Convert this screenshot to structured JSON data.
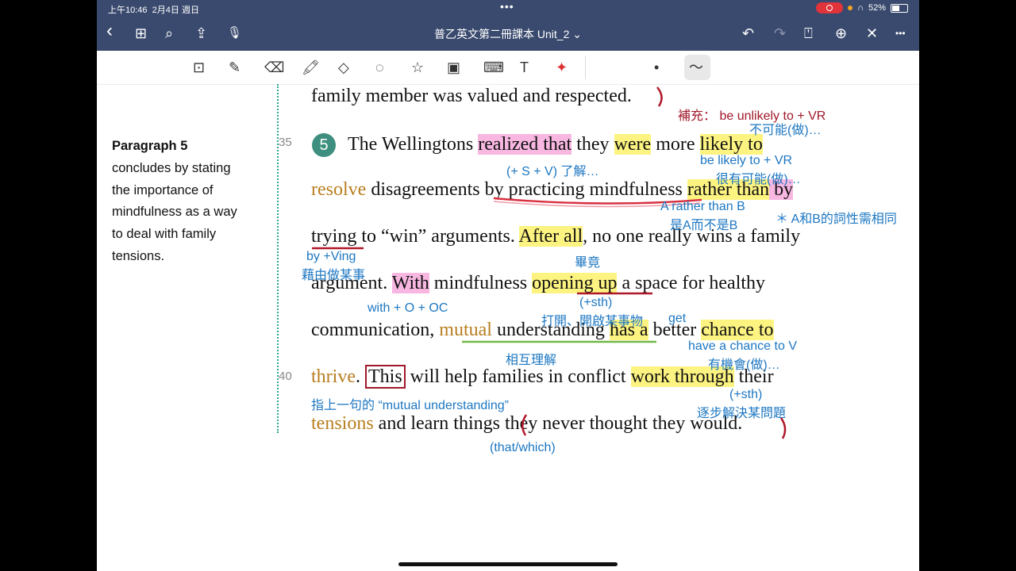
{
  "status": {
    "time": "上午10:46",
    "date": "2月4日 週日",
    "battery": "52%"
  },
  "nav": {
    "title": "普乙英文第二冊課本 Unit_2 ⌄",
    "back": "‹",
    "grid": "⊞",
    "search": "⌕",
    "share": "⇪",
    "mic": "🎙",
    "undo": "↶",
    "redo": "↷",
    "bookmark": "⍞",
    "add": "⊕",
    "close": "✕",
    "more": "•••"
  },
  "tools": {
    "lasso_zoom": "⊡",
    "pen": "✎",
    "eraser": "⌫",
    "highlighter": "🖍",
    "shapes": "◇",
    "lasso": "◌",
    "sticker": "☆",
    "image": "▣",
    "keyboard": "⌨",
    "textbox": "T",
    "laser": "✦",
    "dot": "•",
    "stroke": "〜"
  },
  "sidebar": {
    "heading": "Paragraph 5",
    "line1": "concludes by stating",
    "line2": "the importance of",
    "line3": "mindfulness as a way",
    "line4": "to deal with family",
    "line5": "tensions."
  },
  "line_numbers": {
    "n35": "35",
    "n40": "40"
  },
  "paragraph_number": "5",
  "text": {
    "l0": "family member was valued and respected.",
    "l1_a": "The Wellingtons ",
    "l1_b": "realized that",
    "l1_c": " they ",
    "l1_d": "were",
    "l1_e": " more ",
    "l1_f": "likely to",
    "l2_a": "resolve",
    "l2_b": " disagreements by practicing mindfulness ",
    "l2_c": "rather than",
    "l2_d": " by",
    "l3_a": "trying",
    "l3_b": " to “win” arguments. ",
    "l3_c": "After all",
    "l3_d": ", no one really wins a family",
    "l4_a": "argument. ",
    "l4_b": "With",
    "l4_c": " mindfulness ",
    "l4_d": "opening up",
    "l4_e": " a space for healthy",
    "l5_a": "communication, ",
    "l5_b": "mutual",
    "l5_c": " understanding ",
    "l5_d": "has a",
    "l5_e": " better ",
    "l5_f": "chance to",
    "l6_a": "thrive",
    "l6_b": ". ",
    "l6_c": "This",
    "l6_d": " will help families in conflict ",
    "l6_e": "work through",
    "l6_f": " their",
    "l7_a": "tensions",
    "l7_b": " and learn things they never thought they would."
  },
  "annotations": {
    "a1_red": "補充：  be unlikely to + VR",
    "a1b": "不可能(做)…",
    "a2": "(+ S + V) 了解…",
    "a3": "be likely to + VR",
    "a3b": "很有可能(做)…",
    "a4": "A rather than B",
    "a4b": "是A而不是B",
    "a5": "＊ A和B的詞性需相同",
    "a6": "by +Ving",
    "a6b": "藉由做某事",
    "a7": "畢竟",
    "a8": "with + O + OC",
    "a9": "(+sth)",
    "a9b": "打開、開啟某事物",
    "a10": "get",
    "a11": "have a chance to V",
    "a11b": "有機會(做)…",
    "a12": "相互理解",
    "a13": "指上一句的 “mutual understanding”",
    "a14": "(+sth)",
    "a14b": "逐步解決某問題",
    "a15": "(that/which)"
  },
  "colors": {
    "nav_bg": "#3a4a6e",
    "highlight_yellow": "#fcf381",
    "highlight_pink": "#f7b7e1",
    "ink_blue": "#1d77c2",
    "ink_red": "#a0182a",
    "word_orange": "#b87e1f",
    "para_green": "#3e8f7f"
  }
}
